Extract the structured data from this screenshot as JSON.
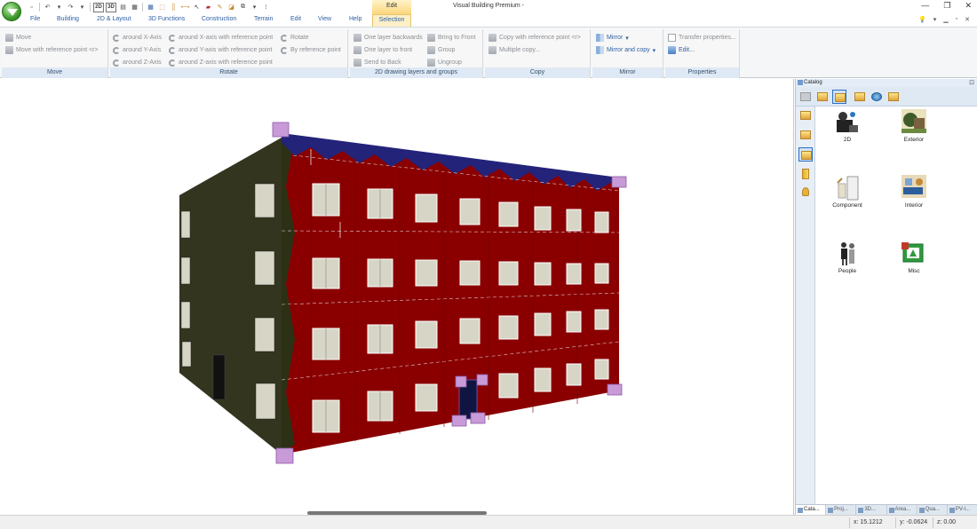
{
  "app": {
    "title": "Visual Building Premium -",
    "contextual_header": "Edit"
  },
  "tabs": [
    "File",
    "Building",
    "2D & Layout",
    "3D Functions",
    "Construction",
    "Terrain",
    "Edit",
    "View",
    "Help",
    "Selection"
  ],
  "active_tab": "Selection",
  "ribbon": {
    "move": {
      "label": "Move",
      "items": [
        "Move",
        "Move with reference point <r>"
      ]
    },
    "rotate": {
      "label": "Rotate",
      "axis_items": [
        "around X-Axis",
        "around Y-Axis",
        "around Z-Axis"
      ],
      "axis_ref_items": [
        "around X-axis with reference point",
        "around Y-axis with reference point",
        "around Z-axis with reference point"
      ],
      "other_items": [
        "Rotate",
        "By reference point"
      ]
    },
    "layers": {
      "label": "2D drawing layers and groups",
      "items": [
        "One layer backwards",
        "One layer to front",
        "Send to Back"
      ],
      "group_items": [
        "Bring to Front",
        "Group",
        "Ungroup"
      ]
    },
    "copy": {
      "label": "Copy",
      "items": [
        "Copy with reference point <r>",
        "Multiple copy..."
      ]
    },
    "mirror": {
      "label": "Mirror",
      "items": [
        "Mirror",
        "Mirror and copy"
      ]
    },
    "properties": {
      "label": "Properties",
      "items": [
        "Transfer properties...",
        "Edit..."
      ]
    }
  },
  "catalog": {
    "title": "Catalog",
    "items": [
      "2D",
      "Exterior",
      "Component",
      "Interior",
      "People",
      "Misc"
    ],
    "bottom_tabs": [
      "Cata...",
      "Proj...",
      "3D...",
      "Area...",
      "Qua...",
      "PV-I..."
    ]
  },
  "status": {
    "x": "x: 15.1212",
    "y": "y: -0.0624",
    "z": "z: 0.00"
  },
  "colors": {
    "facade": "#8a0000",
    "side_wall": "#33351f",
    "roof_trim": "#24237a",
    "ribbon_label_bg": "#dfe9f5",
    "accent": "#2d5fa3",
    "contextual_tab": "#fbd77c",
    "handle": "#c89ad8"
  },
  "icons": {
    "app_logo": "green-down-arrow-logo",
    "help": "help-icon",
    "minimize": "minimize-icon",
    "maximize": "maximize-icon",
    "close": "close-icon"
  }
}
